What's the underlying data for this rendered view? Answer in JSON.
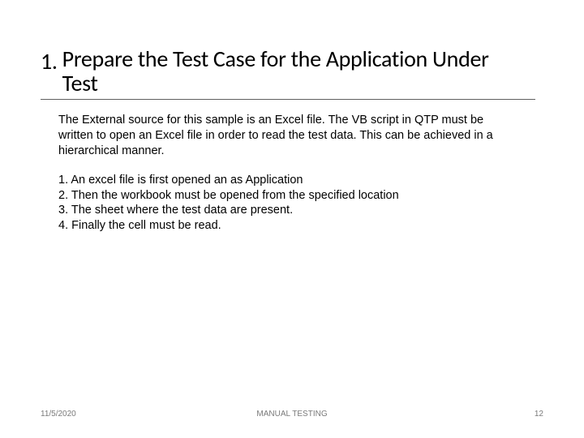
{
  "title": {
    "number": "1.",
    "text": "Prepare the Test Case for the Application Under Test"
  },
  "body": {
    "paragraph": "The External source for this sample is an Excel file. The VB script in QTP must be written to open an Excel file in order to read the test data. This can be achieved in a hierarchical manner.",
    "steps": [
      "1. An excel file is first opened an as Application",
      "2. Then the workbook must be opened from the specified location",
      "3. The sheet where the test data are present.",
      "4. Finally the cell must be read."
    ]
  },
  "footer": {
    "date": "11/5/2020",
    "center": "MANUAL TESTING",
    "page": "12"
  }
}
